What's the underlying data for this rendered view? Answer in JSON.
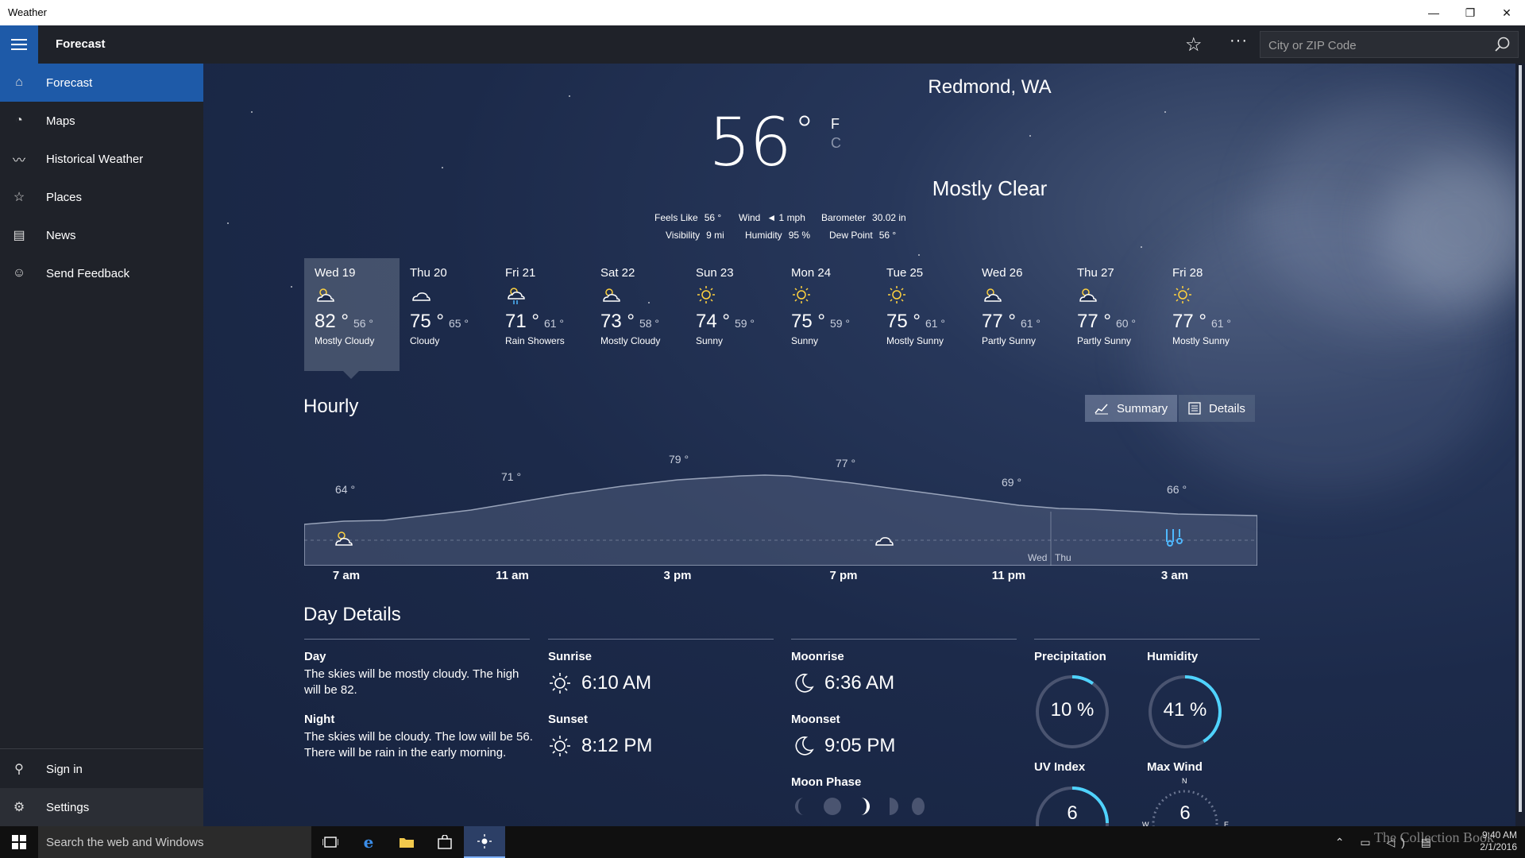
{
  "window": {
    "title": "Weather",
    "minimize": "—",
    "restore": "❐",
    "close": "✕"
  },
  "header": {
    "app_title": "Forecast",
    "favorite_icon": "star-outline-icon",
    "more": "···",
    "search_placeholder": "City or ZIP Code"
  },
  "sidebar": {
    "items": [
      {
        "label": "Forecast",
        "icon": "⌂",
        "active": true
      },
      {
        "label": "Maps",
        "icon": "◔"
      },
      {
        "label": "Historical Weather",
        "icon": "〰"
      },
      {
        "label": "Places",
        "icon": "☆"
      },
      {
        "label": "News",
        "icon": "▤"
      },
      {
        "label": "Send Feedback",
        "icon": "☺"
      }
    ],
    "bottom": [
      {
        "label": "Sign in",
        "icon": "⚲"
      },
      {
        "label": "Settings",
        "icon": "⚙"
      }
    ]
  },
  "current": {
    "location": "Redmond, WA",
    "temperature": "56",
    "degree": "°",
    "unit_f": "F",
    "unit_c": "C",
    "condition": "Mostly Clear",
    "feels_like_label": "Feels Like",
    "feels_like": "56 °",
    "wind_label": "Wind",
    "wind": "◄ 1 mph",
    "barometer_label": "Barometer",
    "barometer": "30.02 in",
    "visibility_label": "Visibility",
    "visibility": "9 mi",
    "humidity_label": "Humidity",
    "humidity": "95 %",
    "dew_point_label": "Dew Point",
    "dew_point": "56 °"
  },
  "daily": [
    {
      "day": "Wed 19",
      "hi": "82 °",
      "lo": "56 °",
      "cond": "Mostly Cloudy",
      "icon": "partly-cloudy-icon",
      "selected": true
    },
    {
      "day": "Thu 20",
      "hi": "75 °",
      "lo": "65 °",
      "cond": "Cloudy",
      "icon": "cloudy-icon"
    },
    {
      "day": "Fri 21",
      "hi": "71 °",
      "lo": "61 °",
      "cond": "Rain Showers",
      "icon": "rain-showers-icon"
    },
    {
      "day": "Sat 22",
      "hi": "73 °",
      "lo": "58 °",
      "cond": "Mostly Cloudy",
      "icon": "partly-cloudy-icon"
    },
    {
      "day": "Sun 23",
      "hi": "74 °",
      "lo": "59 °",
      "cond": "Sunny",
      "icon": "sunny-icon"
    },
    {
      "day": "Mon 24",
      "hi": "75 °",
      "lo": "59 °",
      "cond": "Sunny",
      "icon": "sunny-icon"
    },
    {
      "day": "Tue 25",
      "hi": "75 °",
      "lo": "61 °",
      "cond": "Mostly Sunny",
      "icon": "sunny-icon"
    },
    {
      "day": "Wed 26",
      "hi": "77 °",
      "lo": "61 °",
      "cond": "Partly Sunny",
      "icon": "partly-cloudy-icon"
    },
    {
      "day": "Thu 27",
      "hi": "77 °",
      "lo": "60 °",
      "cond": "Partly Sunny",
      "icon": "partly-cloudy-icon"
    },
    {
      "day": "Fri 28",
      "hi": "77 °",
      "lo": "61 °",
      "cond": "Mostly Sunny",
      "icon": "sunny-icon"
    }
  ],
  "hourly": {
    "title": "Hourly",
    "summary_label": "Summary",
    "details_label": "Details",
    "temp_labels": [
      "64 °",
      "71 °",
      "79 °",
      "77 °",
      "69 °",
      "66 °"
    ],
    "times": [
      "7 am",
      "11 am",
      "3 pm",
      "7 pm",
      "11 pm",
      "3 am"
    ],
    "day_split": [
      "Wed",
      "Thu"
    ]
  },
  "day_details": {
    "title": "Day Details",
    "day_label": "Day",
    "day_text": "The skies will be mostly cloudy. The high will be 82.",
    "night_label": "Night",
    "night_text": "The skies will be cloudy. The low will be 56. There will be rain in the early morning.",
    "sunrise_label": "Sunrise",
    "sunrise": "6:10 AM",
    "sunset_label": "Sunset",
    "sunset": "8:12 PM",
    "moonrise_label": "Moonrise",
    "moonrise": "6:36 AM",
    "moonset_label": "Moonset",
    "moonset": "9:05 PM",
    "moon_phase_label": "Moon Phase",
    "precip_label": "Precipitation",
    "precip": "10 %",
    "precip_fraction": 0.1,
    "humidity_label": "Humidity",
    "humidity": "41 %",
    "humidity_fraction": 0.41,
    "uv_label": "UV Index",
    "uv": "6",
    "wind_label": "Max Wind",
    "wind": "6",
    "compass": [
      "N",
      "W",
      "E"
    ]
  },
  "taskbar": {
    "search_text": "Search the web and Windows",
    "time": "9:40 AM",
    "date": "2/1/2016",
    "watermark": "The Collection Book"
  },
  "colors": {
    "accent": "#1e5aa8",
    "gauge": "#4fd3ff",
    "sun": "#ffd23f"
  }
}
